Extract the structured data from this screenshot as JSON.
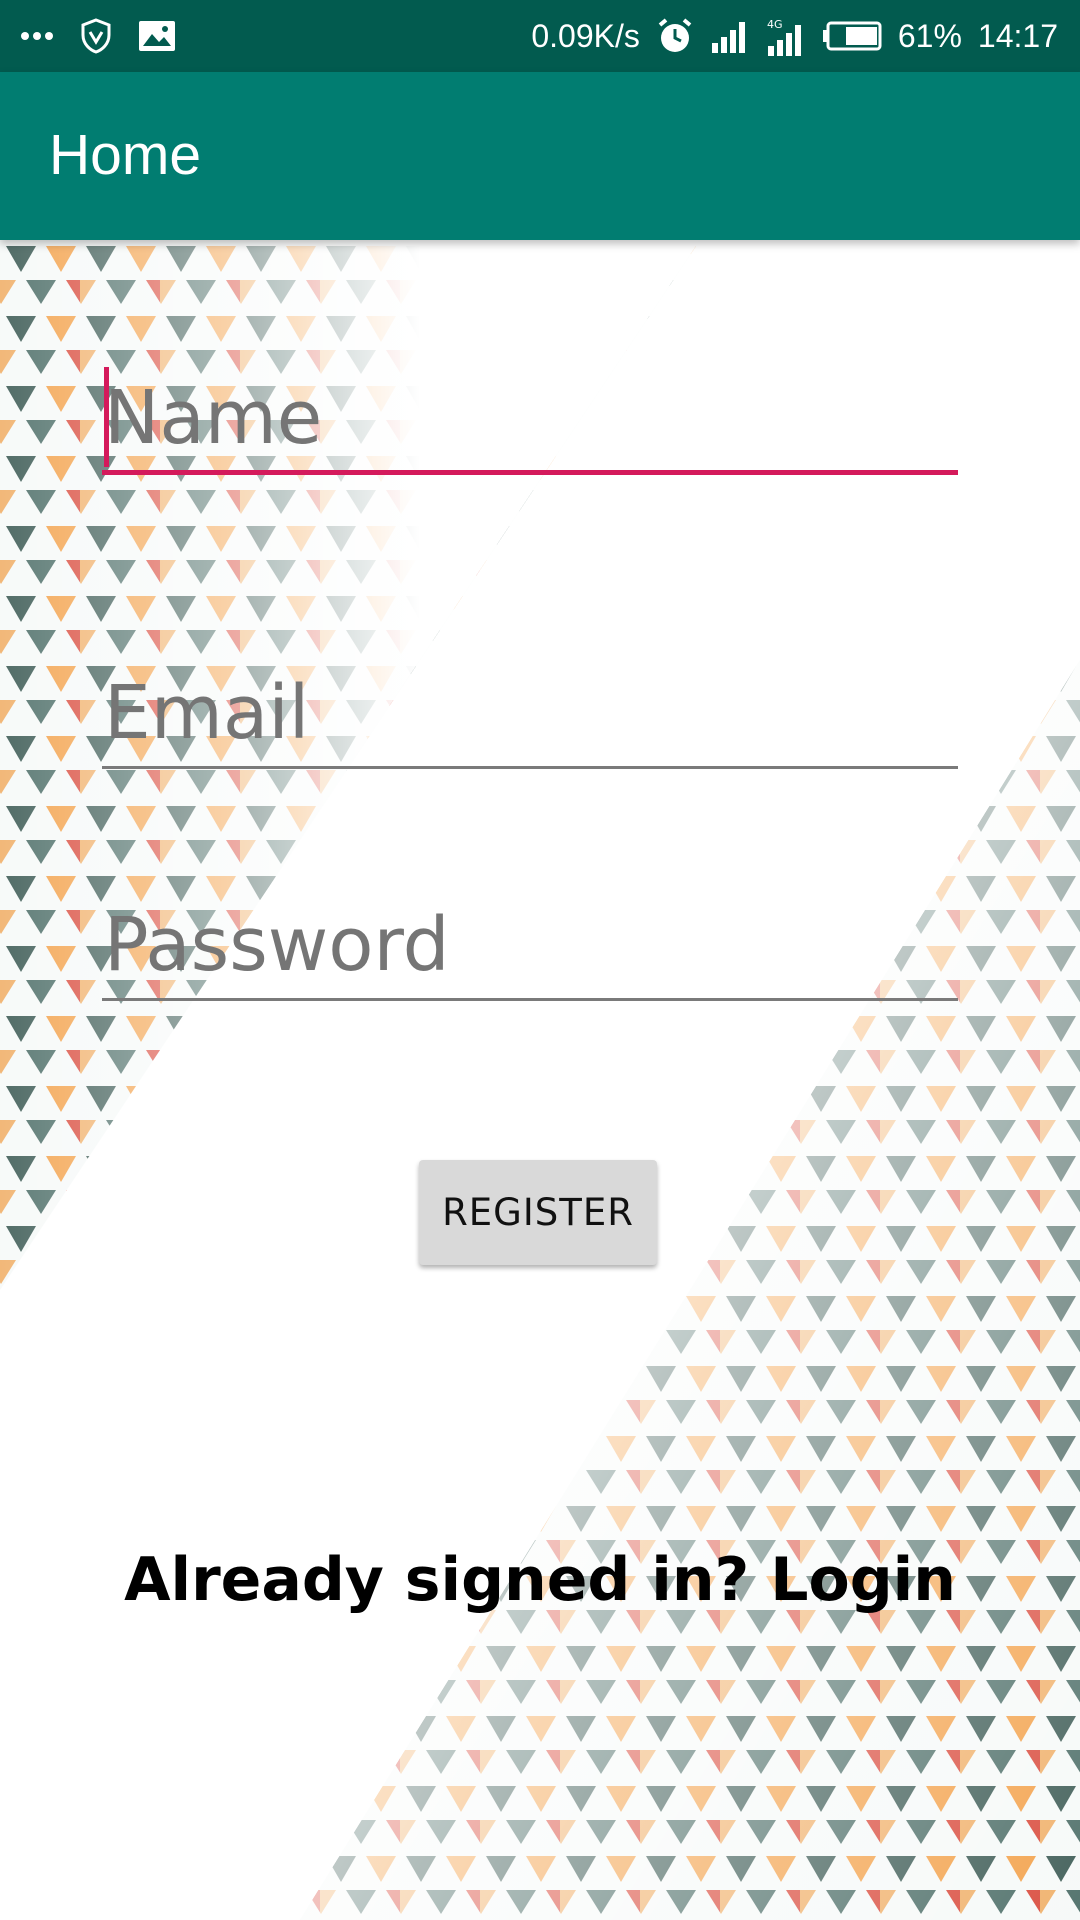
{
  "status_bar": {
    "network_speed": "0.09K/s",
    "battery_percent": "61%",
    "time": "14:17",
    "icons": [
      "more-dots-icon",
      "shield-icon",
      "image-icon",
      "alarm-icon",
      "signal-icon",
      "signal-4g-icon",
      "battery-icon"
    ]
  },
  "app_bar": {
    "title": "Home",
    "color": "#017d71"
  },
  "form": {
    "name": {
      "placeholder": "Name",
      "value": ""
    },
    "email": {
      "placeholder": "Email",
      "value": ""
    },
    "password": {
      "placeholder": "Password",
      "value": ""
    },
    "register_label": "REGISTER",
    "focus_color": "#d41a5b"
  },
  "login_link": "Already signed in? Login"
}
